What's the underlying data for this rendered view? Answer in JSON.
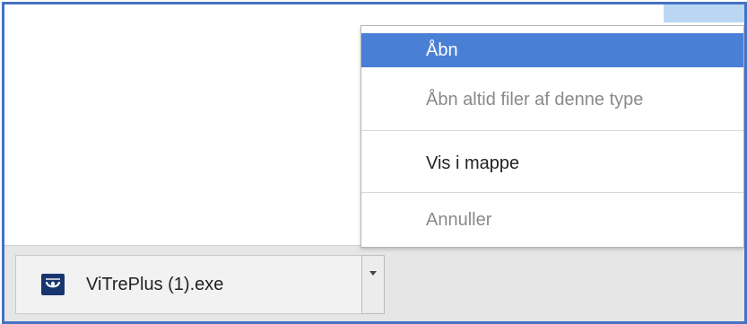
{
  "colors": {
    "frame_border": "#4472c4",
    "menu_highlight": "#4a7fd6",
    "disabled_text": "#8a8a8a",
    "download_bar": "#e6e6e6"
  },
  "download": {
    "file_name": "ViTrePlus (1).exe",
    "file_icon": "vitreplus-app-icon",
    "dropdown_icon": "chevron-down-icon"
  },
  "menu": {
    "items": [
      {
        "label": "Åbn",
        "state": "highlighted"
      },
      {
        "label": "Åbn altid filer af denne type",
        "state": "disabled"
      },
      {
        "label": "Vis i mappe",
        "state": "enabled"
      },
      {
        "label": "Annuller",
        "state": "disabled"
      }
    ]
  }
}
